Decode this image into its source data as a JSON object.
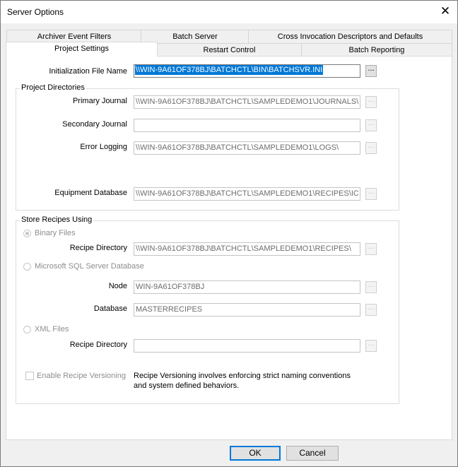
{
  "window": {
    "title": "Server Options",
    "close_glyph": "✕"
  },
  "tabs_back": [
    "Archiver Event Filters",
    "Batch Server",
    "Cross Invocation Descriptors and Defaults"
  ],
  "tabs_front": [
    "Project Settings",
    "Restart Control",
    "Batch Reporting"
  ],
  "init_file": {
    "label": "Initialization File Name",
    "value": "\\\\WIN-9A61OF378BJ\\BATCHCTL\\BIN\\BATCHSVR.INI",
    "browse": "..."
  },
  "project_dirs": {
    "title": "Project Directories",
    "primary_label": "Primary Journal",
    "primary_value": "\\\\WIN-9A61OF378BJ\\BATCHCTL\\SAMPLEDEMO1\\JOURNALS\\",
    "secondary_label": "Secondary Journal",
    "secondary_value": "",
    "error_label": "Error Logging",
    "error_value": "\\\\WIN-9A61OF378BJ\\BATCHCTL\\SAMPLEDEMO1\\LOGS\\",
    "equipment_label": "Equipment Database",
    "equipment_value": "\\\\WIN-9A61OF378BJ\\BATCHCTL\\SAMPLEDEMO1\\RECIPES\\IC",
    "browse": "..."
  },
  "store": {
    "title": "Store Recipes Using",
    "binary_label": "Binary Files",
    "binary_dir_label": "Recipe Directory",
    "binary_dir_value": "\\\\WIN-9A61OF378BJ\\BATCHCTL\\SAMPLEDEMO1\\RECIPES\\",
    "sql_label": "Microsoft SQL Server Database",
    "node_label": "Node",
    "node_value": "WIN-9A61OF378BJ",
    "database_label": "Database",
    "database_value": "MASTERRECIPES",
    "xml_label": "XML Files",
    "xml_dir_label": "Recipe Directory",
    "xml_dir_value": "",
    "versioning_label": "Enable Recipe Versioning",
    "versioning_note_1": "Recipe Versioning involves enforcing strict naming conventions",
    "versioning_note_2": "and system defined behaviors.",
    "browse": "...",
    "selected_option": "Binary Files"
  },
  "footer": {
    "ok": "OK",
    "cancel": "Cancel"
  }
}
